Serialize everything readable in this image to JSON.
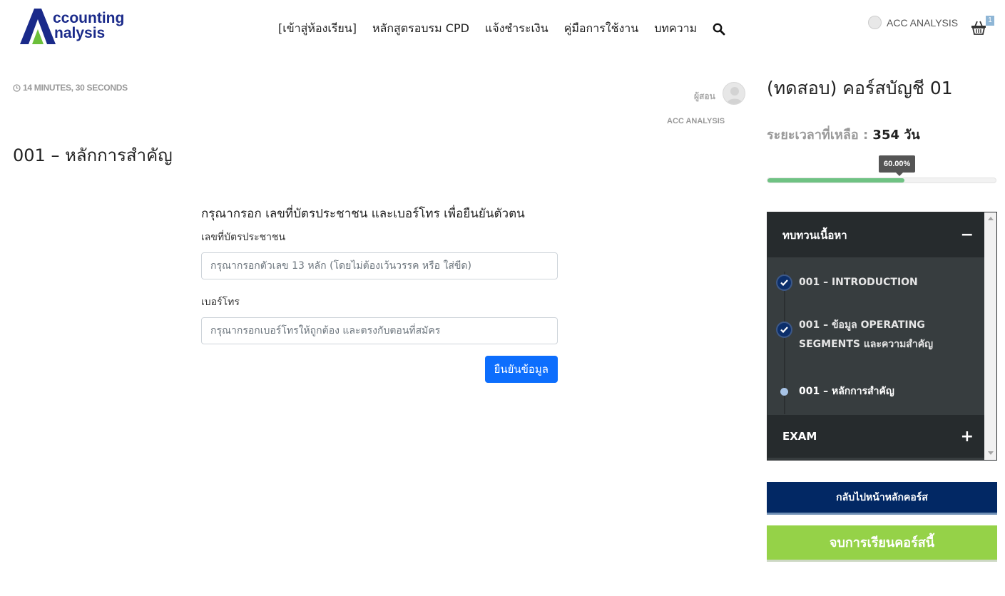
{
  "header": {
    "logo_line1": "ccounting",
    "logo_line2": "nalysis",
    "nav": [
      {
        "label": "[เข้าสู่ห้องเรียน]"
      },
      {
        "label": "หลักสูตรอบรม CPD"
      },
      {
        "label": "แจ้งชำระเงิน"
      },
      {
        "label": "คู่มือการใช้งาน"
      },
      {
        "label": "บทความ"
      }
    ],
    "search_icon": "search-icon",
    "user_name": "ACC ANALYSIS",
    "cart_icon": "basket-icon",
    "cart_count": "1"
  },
  "lesson": {
    "duration": "14 MINUTES, 30 SECONDS",
    "instructor_label": "ผู้สอน",
    "instructor_name": "ACC ANALYSIS",
    "title": "001 – หลักการสำคัญ"
  },
  "form": {
    "heading": "กรุณากรอก เลขที่บัตรประชาชน และเบอร์โทร เพื่อยืนยันตัวตน",
    "id_label": "เลขที่บัตรประชาชน",
    "id_placeholder": "กรุณากรอกตัวเลข 13 หลัก (โดยไม่ต้องเว้นวรรค หรือ ใส่ขีด)",
    "id_value": "",
    "phone_label": "เบอร์โทร",
    "phone_placeholder": "กรุณากรอกเบอร์โทรให้ถูกต้อง และตรงกับตอนที่สมัคร",
    "phone_value": "",
    "submit_label": "ยืนยันข้อมูล",
    "submit_color": "#0d6efd"
  },
  "sidebar": {
    "course_title": "(ทดสอบ) คอร์สบัญชี 01",
    "time_left_label": "ระยะเวลาที่เหลือ :",
    "time_left_value": "354 วัน",
    "progress_label": "60.00%",
    "progress_fraction": 0.6,
    "progress_color": "#6fc283",
    "sections": [
      {
        "title": "ทบทวนเนื้อหา",
        "toggle": "−",
        "lessons": [
          {
            "label": "001 – INTRODUCTION",
            "status": "complete"
          },
          {
            "label": "001 – ข้อมูล OPERATING SEGMENTS และความสำคัญ",
            "status": "complete"
          },
          {
            "label": "001 – หลักการสำคัญ",
            "status": "current"
          }
        ]
      },
      {
        "title": "EXAM",
        "toggle": "+"
      }
    ],
    "back_button": "กลับไปหน้าหลักคอร์ส",
    "back_color": "#022864",
    "finish_button": "จบการเรียนคอร์สนี้",
    "finish_color": "#95d248"
  }
}
